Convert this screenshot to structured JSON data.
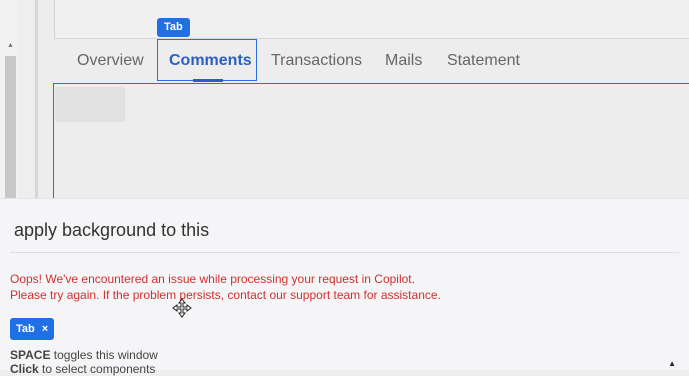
{
  "tabs": {
    "tag_label": "Tab",
    "items": [
      {
        "label": "Overview"
      },
      {
        "label": "Comments"
      },
      {
        "label": "Transactions"
      },
      {
        "label": "Mails"
      },
      {
        "label": "Statement"
      }
    ],
    "active": "Comments"
  },
  "copilot": {
    "prompt": "apply background to this",
    "error_line1": "Oops! We've encountered an issue while processing your request in Copilot.",
    "error_line2": "Please try again. If the problem persists, contact our support team for assistance.",
    "chip_label": "Tab",
    "chip_close": "×",
    "hint_key": "SPACE",
    "hint_text": " toggles this window",
    "hint2_key": "Click",
    "hint2_text": " to select components"
  },
  "colors": {
    "accent": "#1f6fe5",
    "active_tab": "#2c5fc4",
    "error": "#d32f2f"
  }
}
